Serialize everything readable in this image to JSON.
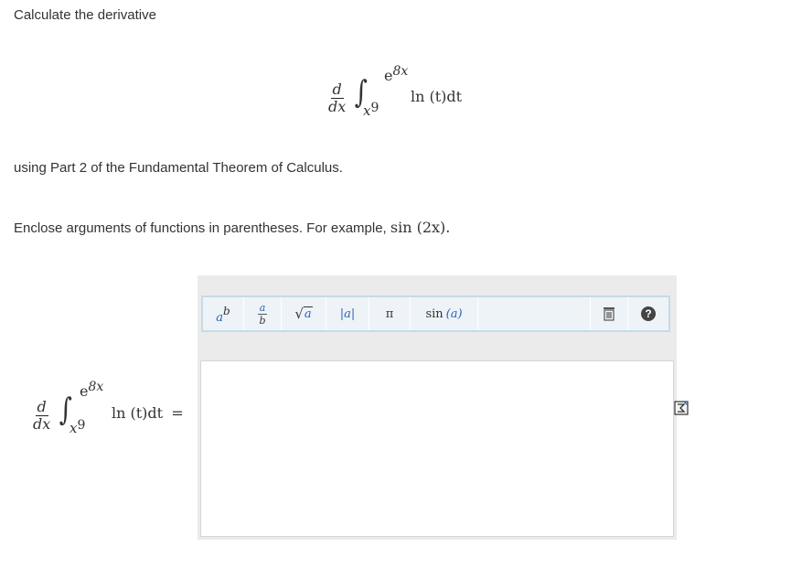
{
  "question": {
    "title": "Calculate the derivative",
    "instruction": "using Part 2 of the Fundamental Theorem of Calculus.",
    "hint_prefix": "Enclose arguments of functions in parentheses. For example,",
    "hint_example": "sin (2x).",
    "expression": {
      "d": "d",
      "dx": "dx",
      "integral": "∫",
      "lower_limit_base": "x",
      "lower_limit_exp": "9",
      "upper_limit_base": "e",
      "upper_limit_exp": "8x",
      "integrand": "ln (t)dt",
      "equals": "="
    }
  },
  "toolbar": {
    "power": {
      "base": "a",
      "exp": "b"
    },
    "fraction": {
      "num": "a",
      "den": "b"
    },
    "sqrt": {
      "symbol": "√",
      "arg": "a"
    },
    "abs": "|a|",
    "pi": "π",
    "sin": {
      "fn": "sin",
      "arg": "(a)"
    },
    "help": "?"
  }
}
